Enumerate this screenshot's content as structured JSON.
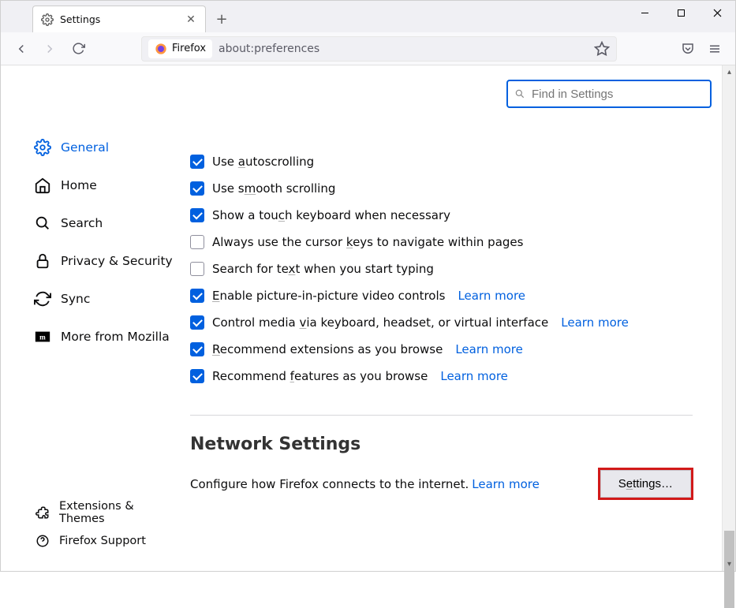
{
  "window": {
    "tab_title": "Settings",
    "identity_label": "Firefox",
    "url": "about:preferences",
    "search_placeholder": "Find in Settings"
  },
  "sidebar": {
    "items": [
      {
        "label": "General"
      },
      {
        "label": "Home"
      },
      {
        "label": "Search"
      },
      {
        "label": "Privacy & Security"
      },
      {
        "label": "Sync"
      },
      {
        "label": "More from Mozilla"
      }
    ],
    "bottom": [
      {
        "label": "Extensions & Themes"
      },
      {
        "label": "Firefox Support"
      }
    ]
  },
  "browsing": {
    "opts": [
      {
        "checked": true,
        "pre": "Use ",
        "u": "a",
        "post": "utoscrolling"
      },
      {
        "checked": true,
        "pre": "Use s",
        "u": "m",
        "post": "ooth scrolling"
      },
      {
        "checked": true,
        "pre": "Show a tou",
        "u": "c",
        "post": "h keyboard when necessary"
      },
      {
        "checked": false,
        "pre": "Always use the cursor ",
        "u": "k",
        "post": "eys to navigate within pages"
      },
      {
        "checked": false,
        "pre": "Search for te",
        "u": "x",
        "post": "t when you start typing"
      },
      {
        "checked": true,
        "pre": "",
        "u": "E",
        "post": "nable picture-in-picture video controls",
        "learn": "Learn more"
      },
      {
        "checked": true,
        "pre": "Control media ",
        "u": "v",
        "post": "ia keyboard, headset, or virtual interface",
        "learn": "Learn more"
      },
      {
        "checked": true,
        "pre": "",
        "u": "R",
        "post": "ecommend extensions as you browse",
        "learn": "Learn more"
      },
      {
        "checked": true,
        "pre": "Recommend ",
        "u": "f",
        "post": "eatures as you browse",
        "learn": "Learn more"
      }
    ]
  },
  "network": {
    "title": "Network Settings",
    "desc": "Configure how Firefox connects to the internet.",
    "learn": "Learn more",
    "btn_pre": "S",
    "btn_u": "e",
    "btn_post": "ttings…"
  }
}
